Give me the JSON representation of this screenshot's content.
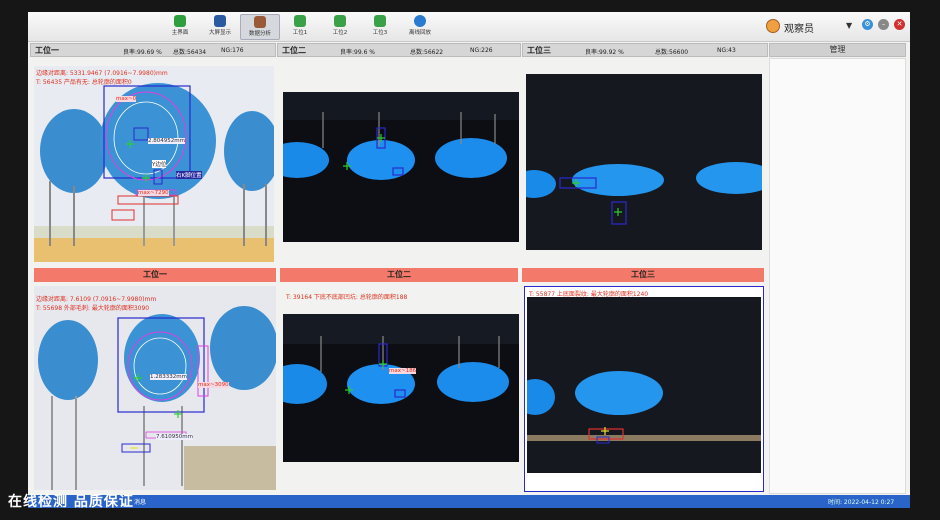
{
  "toolbar": {
    "items": [
      {
        "label": "主界面",
        "icon": "shield-icon",
        "color": "#2e9e3e"
      },
      {
        "label": "大屏显示",
        "icon": "display-icon",
        "color": "#2c5aa0"
      },
      {
        "label": "数据分析",
        "icon": "chart-icon",
        "color": "#9a5a3a"
      },
      {
        "label": "工位1",
        "icon": "station-icon",
        "color": "#3aa04a"
      },
      {
        "label": "工位2",
        "icon": "station-icon",
        "color": "#3aa04a"
      },
      {
        "label": "工位3",
        "icon": "station-icon",
        "color": "#3aa04a"
      },
      {
        "label": "离线回放",
        "icon": "cloud-icon",
        "color": "#2a7ad0"
      }
    ],
    "user": "观察员"
  },
  "stations": [
    {
      "title": "工位一",
      "rate": "良率:99.69 %",
      "total": "总数:56434",
      "ng": "NG:176"
    },
    {
      "title": "工位二",
      "rate": "良率:99.6 %",
      "total": "总数:56622",
      "ng": "NG:226"
    },
    {
      "title": "工位三",
      "rate": "良率:99.92 %",
      "total": "总数:56600",
      "ng": "NG:43"
    }
  ],
  "management": {
    "title": "管理"
  },
  "row1": {
    "s1_line1": "边缘对距离: 5331.9467 (7.0916~7.9980)mm",
    "s1_line2": "T: 56435 产品有无: 总轮廓的面积0",
    "s1_labels": {
      "max": "max~0",
      "dist": "2.804952mm",
      "y": "Y边位",
      "pos": "右K脚位置",
      "max2": "max~7290"
    }
  },
  "ng_headers": [
    "工位一",
    "工位二",
    "工位三"
  ],
  "row2": {
    "s1_line1": "边缘对距离: 7.6109 (7.0916~7.9980)mm",
    "s1_line2": "T: 55698 外部毛刺: 最大轮廓的面积3090",
    "s1_labels": {
      "dist": "1.283332mm",
      "max": "max~3090",
      "dist2": "7.610950mm"
    },
    "s2_line1": "T: 39164 下底不底部凹坑: 总轮廓的面积188",
    "s2_labels": {
      "max": "max~186"
    },
    "s3_line1": "T: 55877 上底面裂纹: 最大轮廓的面积1240"
  },
  "statusbar": {
    "left": "消息",
    "right": "时间: 2022-04-12 0:27"
  },
  "caption": "在线检测 品质保证"
}
